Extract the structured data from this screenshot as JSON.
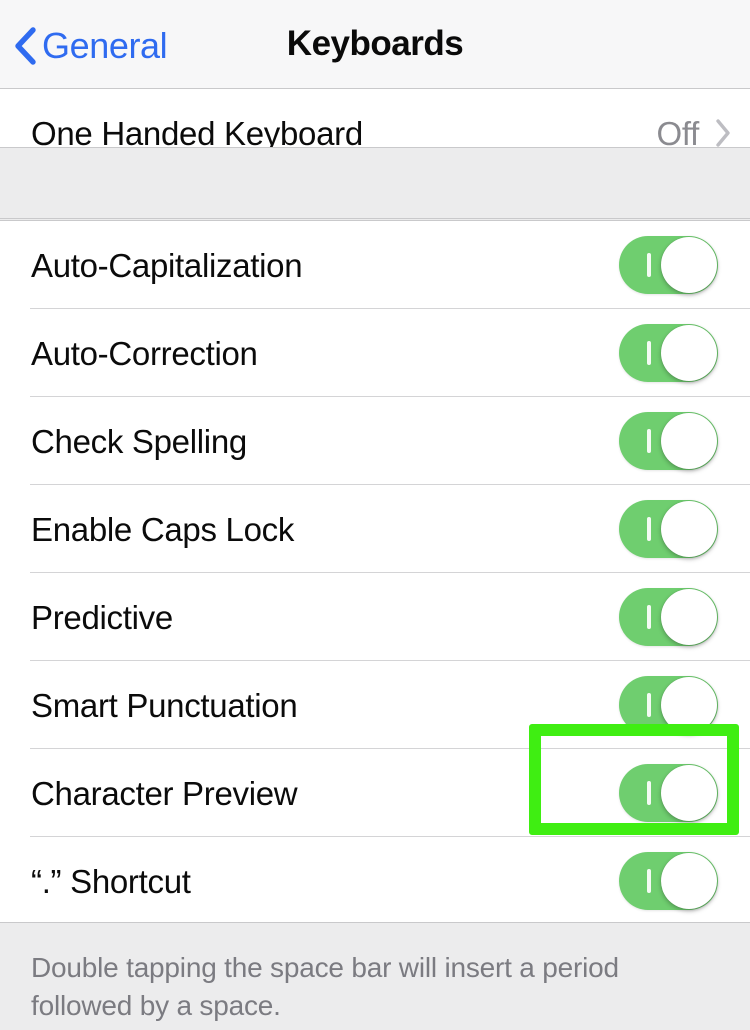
{
  "navbar": {
    "back_label": "General",
    "back_icon": "chevron-left-icon",
    "title": "Keyboards"
  },
  "colors": {
    "accent_blue": "#2f6bf0",
    "toggle_on_green": "#6fce6f",
    "annotation_green": "#3fee12",
    "group_background": "#ececed",
    "row_background": "#ffffff",
    "separator": "#d4d4d6",
    "secondary_text": "#8b8b90"
  },
  "group_top": {
    "rows": [
      {
        "label": "One Handed Keyboard",
        "value": "Off",
        "accessory": "chevron-right-icon",
        "type": "disclosure"
      }
    ]
  },
  "group_main": {
    "rows": [
      {
        "label": "Auto-Capitalization",
        "type": "switch",
        "state": "on",
        "state_label": "On"
      },
      {
        "label": "Auto-Correction",
        "type": "switch",
        "state": "on",
        "state_label": "On"
      },
      {
        "label": "Check Spelling",
        "type": "switch",
        "state": "on",
        "state_label": "On"
      },
      {
        "label": "Enable Caps Lock",
        "type": "switch",
        "state": "on",
        "state_label": "On"
      },
      {
        "label": "Predictive",
        "type": "switch",
        "state": "on",
        "state_label": "On"
      },
      {
        "label": "Smart Punctuation",
        "type": "switch",
        "state": "on",
        "state_label": "On"
      },
      {
        "label": "Character Preview",
        "type": "switch",
        "state": "on",
        "state_label": "On",
        "highlighted": true
      },
      {
        "label": "“.” Shortcut",
        "type": "switch",
        "state": "on",
        "state_label": "On"
      }
    ]
  },
  "footer": {
    "text": "Double tapping the space bar will insert a period followed by a space."
  },
  "annotation": {
    "target": "Character Preview",
    "shape": "rectangle",
    "color": "#3fee12"
  }
}
